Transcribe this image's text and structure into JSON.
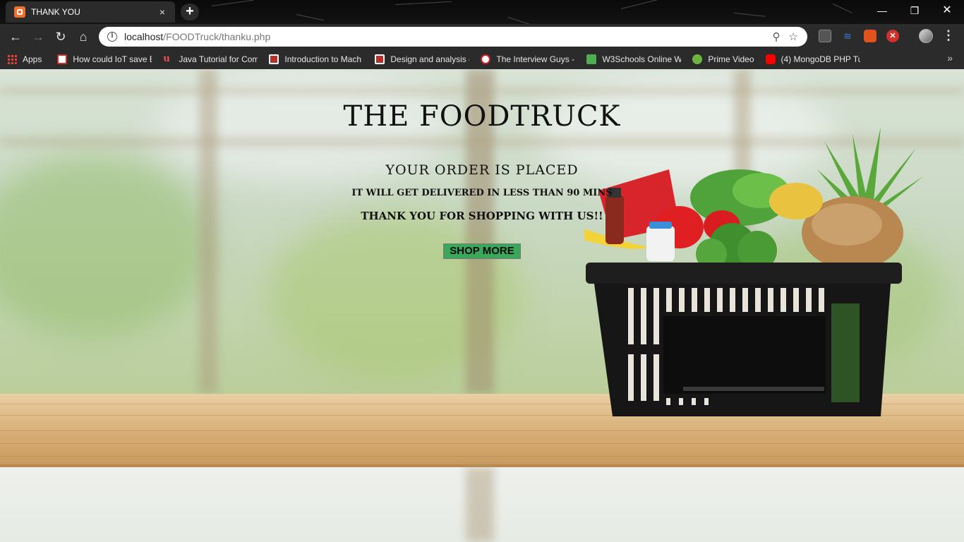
{
  "browser": {
    "tab": {
      "title": "THANK YOU",
      "close_label": "×"
    },
    "new_tab_label": "+",
    "window": {
      "minimize": "—",
      "maximize": "❐",
      "close": "✕"
    },
    "nav": {
      "back": "←",
      "forward": "→",
      "reload": "↻",
      "home": "⌂"
    },
    "address": {
      "host": "localhost",
      "path": "/FOODTruck/thanku.php"
    },
    "menu_label": "⋮"
  },
  "bookmarks": {
    "items": [
      {
        "label": "Apps",
        "icon": "apps-grid-icon",
        "color": "#e94335"
      },
      {
        "label": "How could IoT save E",
        "icon": "id-logo-icon",
        "color": "#d12b2b"
      },
      {
        "label": "Java Tutorial for Com",
        "icon": "udemy-icon",
        "color": "#ec5252"
      },
      {
        "label": "Introduction to Mach",
        "icon": "nptel-icon",
        "color": "#b8302a"
      },
      {
        "label": "Design and analysis c",
        "icon": "nptel-icon",
        "color": "#b8302a"
      },
      {
        "label": "The Interview Guys -",
        "icon": "interview-guys-icon",
        "color": "#cc2222"
      },
      {
        "label": "W3Schools Online W",
        "icon": "w3schools-icon",
        "color": "#4caf50"
      },
      {
        "label": "Prime Video",
        "icon": "play-icon",
        "color": "#6fb33f"
      },
      {
        "label": "(4) MongoDB PHP Tu",
        "icon": "youtube-icon",
        "color": "#ff0000"
      }
    ],
    "overflow_label": "»"
  },
  "page": {
    "title": "THE FOODTRUCK",
    "order_heading": "YOUR ORDER IS PLACED",
    "delivery_text": "IT WILL GET DELIVERED IN LESS THAN 90 MINS",
    "thanks_text": "THANK YOU FOR SHOPPING WITH US!!",
    "shop_more_label": "SHOP MORE"
  }
}
